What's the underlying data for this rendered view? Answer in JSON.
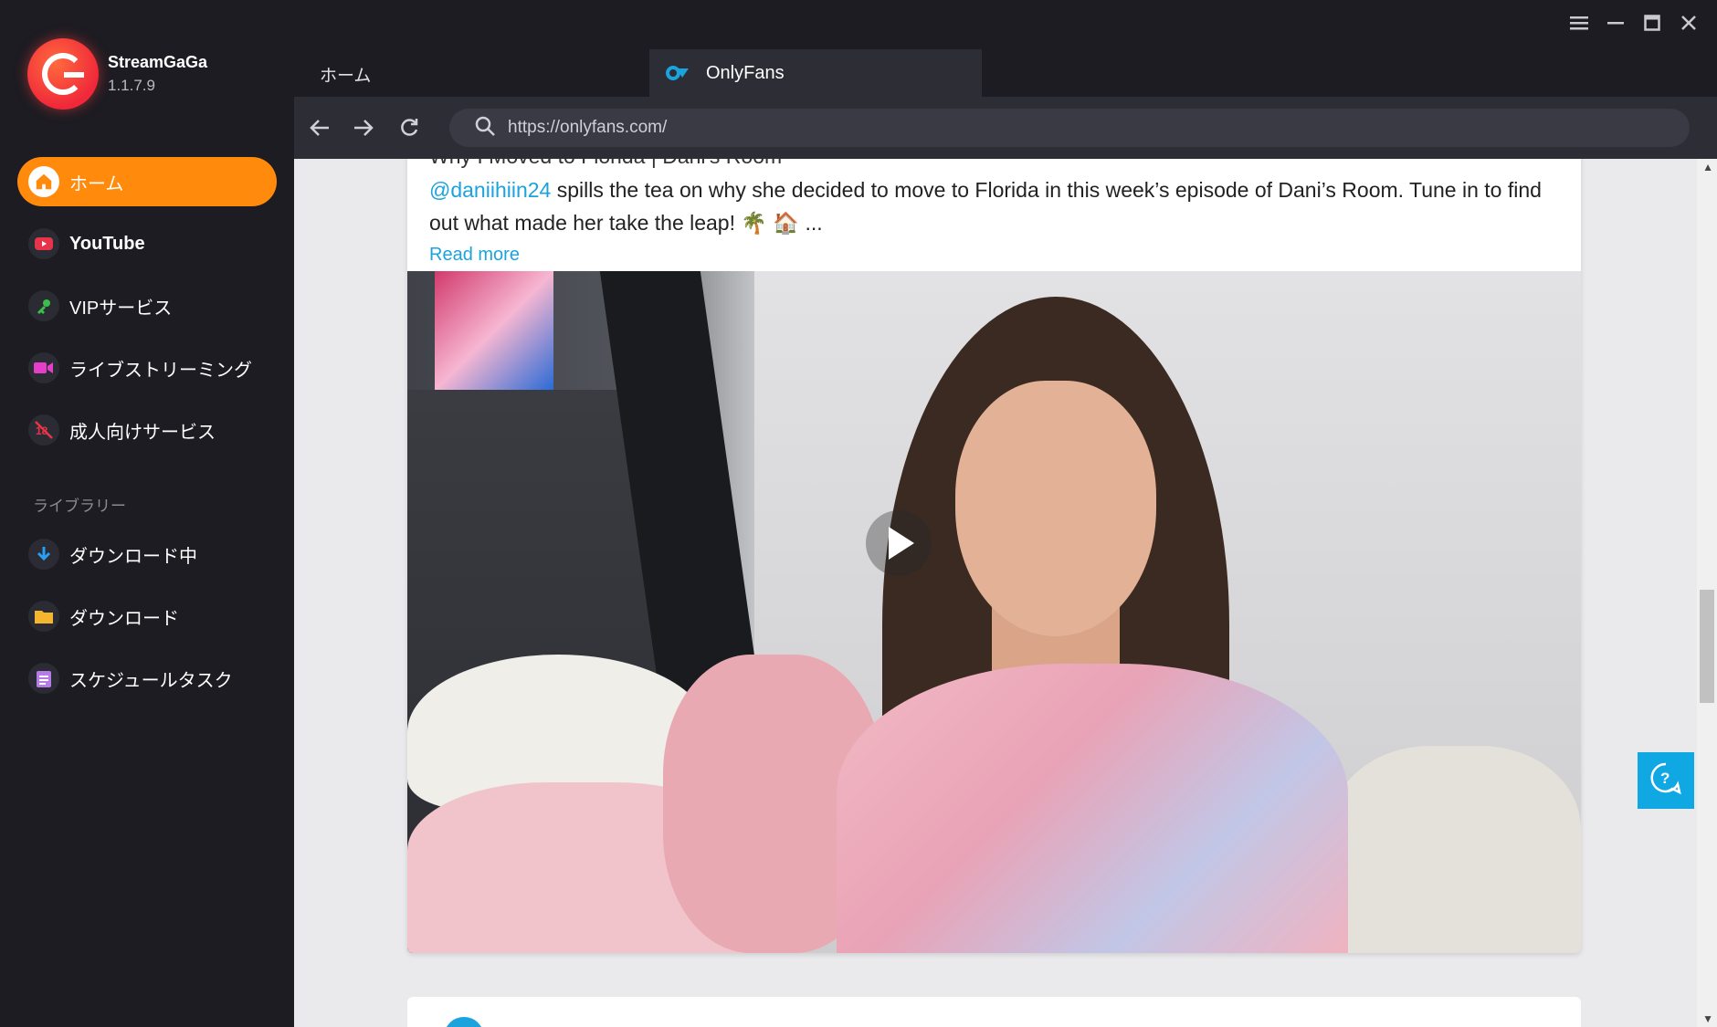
{
  "app": {
    "name": "StreamGaGa",
    "version": "1.1.7.9"
  },
  "sidebar": {
    "items": [
      {
        "label": "ホーム",
        "icon": "home-icon",
        "active": true
      },
      {
        "label": "YouTube",
        "icon": "youtube-icon"
      },
      {
        "label": "VIPサービス",
        "icon": "key-icon"
      },
      {
        "label": "ライブストリーミング",
        "icon": "video-camera-icon"
      },
      {
        "label": "成人向けサービス",
        "icon": "adult-18-icon"
      }
    ],
    "library_heading": "ライブラリー",
    "library_items": [
      {
        "label": "ダウンロード中",
        "icon": "download-arrow-icon"
      },
      {
        "label": "ダウンロード",
        "icon": "folder-icon"
      },
      {
        "label": "スケジュールタスク",
        "icon": "clipboard-icon"
      }
    ]
  },
  "tabs": {
    "home_label": "ホーム",
    "active_label": "OnlyFans"
  },
  "toolbar": {
    "url": "https://onlyfans.com/"
  },
  "post": {
    "title": "Why I Moved to Florida | Dani's Room",
    "mention": "@daniihiin24",
    "description": " spills the tea on why she decided to move to Florida in this week’s episode of Dani’s Room. Tune in to find out what made her take the leap! 🌴 🏠 ...",
    "read_more": "Read more"
  },
  "colors": {
    "accent": "#ff8a0c",
    "link": "#1ba3dd",
    "help": "#10a8e3"
  }
}
